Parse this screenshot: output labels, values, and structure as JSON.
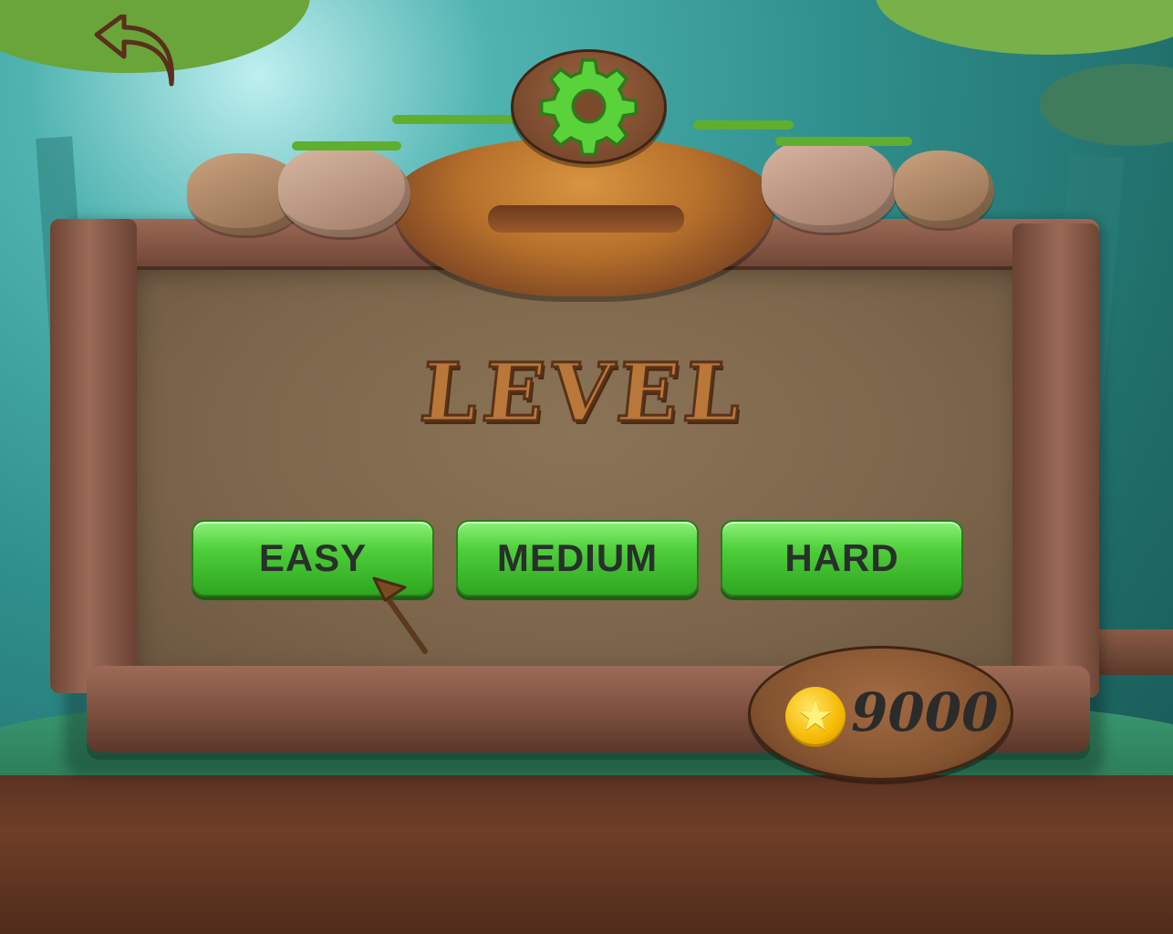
{
  "screen": {
    "title": "LEVEL"
  },
  "icons": {
    "back": "back-arrow-icon",
    "settings": "gear-icon",
    "coin": "star-coin-icon",
    "cursor": "arrow-cursor-icon"
  },
  "levels": [
    {
      "label": "EASY"
    },
    {
      "label": "MEDIUM"
    },
    {
      "label": "HARD"
    }
  ],
  "wallet": {
    "coins": "9000"
  },
  "colors": {
    "button_green": "#4fcf3b",
    "gear_green": "#5ad23a",
    "title_brown": "#b9773a",
    "coin_gold": "#f5b800"
  }
}
